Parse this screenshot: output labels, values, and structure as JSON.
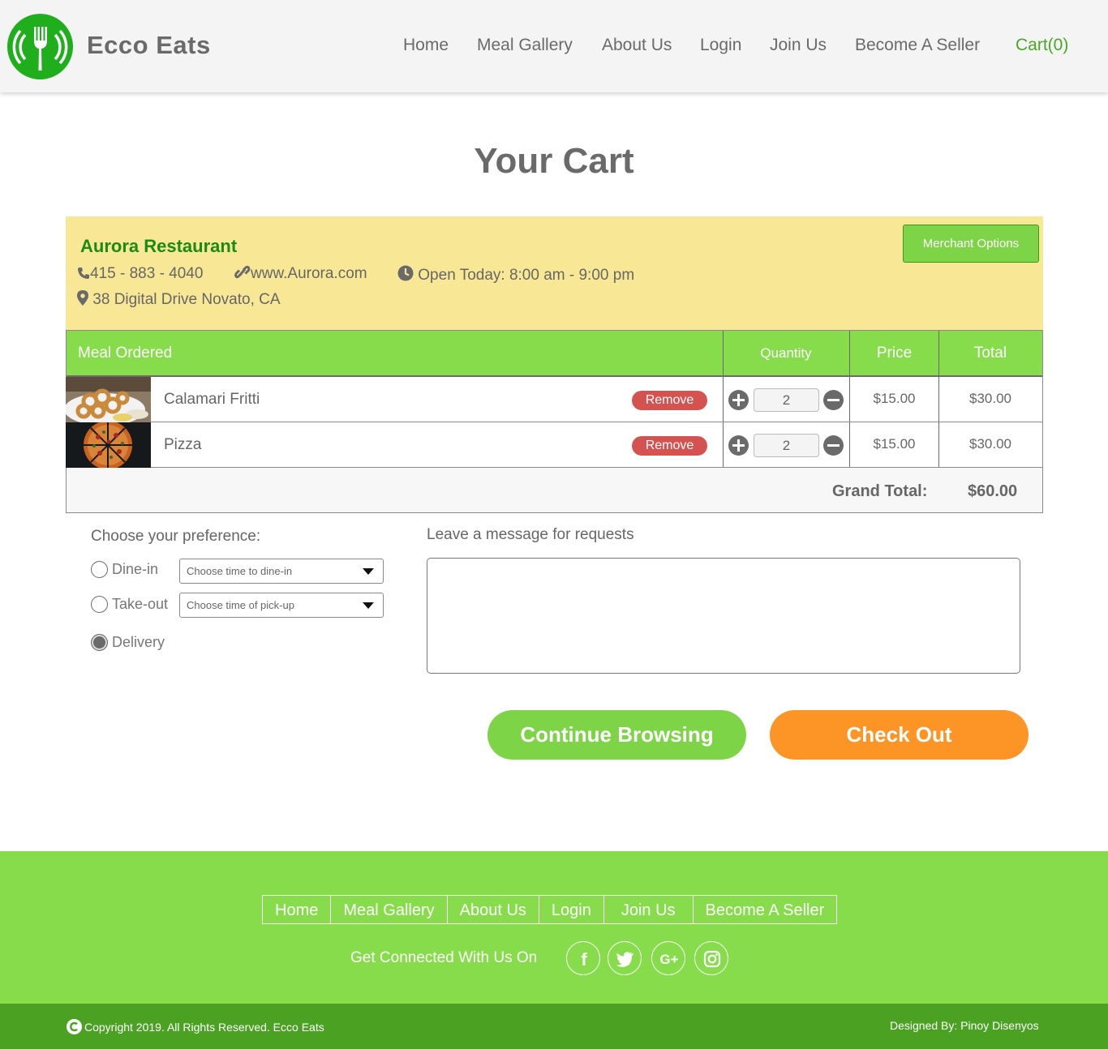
{
  "header": {
    "brand": "Ecco Eats",
    "nav": [
      "Home",
      "Meal Gallery",
      "About Us",
      "Login",
      "Join Us",
      "Become A Seller"
    ],
    "cart_label": "Cart(0)"
  },
  "page": {
    "title": "Your Cart"
  },
  "restaurant": {
    "name": "Aurora Restaurant",
    "phone": "415 - 883 - 4040",
    "website": "www.Aurora.com",
    "hours": "Open Today: 8:00 am - 9:00 pm",
    "address": "38 Digital Drive Novato, CA",
    "merchant_button": "Merchant Options"
  },
  "table": {
    "headers": {
      "meal": "Meal Ordered",
      "quantity": "Quantity",
      "price": "Price",
      "total": "Total"
    },
    "rows": [
      {
        "name": "Calamari Fritti",
        "remove": "Remove",
        "quantity": "2",
        "price": "$15.00",
        "total": "$30.00"
      },
      {
        "name": "Pizza",
        "remove": "Remove",
        "quantity": "2",
        "price": "$15.00",
        "total": "$30.00"
      }
    ],
    "grand_total_label": "Grand Total:",
    "grand_total_value": "$60.00"
  },
  "preferences": {
    "title": "Choose your preference:",
    "options": [
      {
        "label": "Dine-in",
        "select": "Choose time to dine-in",
        "checked": false
      },
      {
        "label": "Take-out",
        "select": "Choose time of pick-up",
        "checked": false
      },
      {
        "label": "Delivery",
        "checked": true
      }
    ]
  },
  "message": {
    "title": "Leave a message for requests",
    "value": ""
  },
  "actions": {
    "continue": "Continue Browsing",
    "checkout": "Check Out"
  },
  "colors": {
    "accent_green": "#86dc4a",
    "dark_green": "#4aa122",
    "orange": "#fd9426",
    "remove_red": "#d45350",
    "panel_yellow": "#f8e895"
  },
  "footer": {
    "nav": [
      "Home",
      "Meal Gallery",
      "About Us",
      "Login",
      "Join Us",
      "Become A Seller"
    ],
    "connect": "Get Connected With Us On",
    "social_icons": [
      "facebook-icon",
      "twitter-icon",
      "google-plus-icon",
      "instagram-icon"
    ],
    "social_labels": [
      "f",
      "G+"
    ],
    "copyright": "Copyright 2019. All Rights Reserved. Ecco Eats",
    "designed_by": "Designed By: Pinoy Disenyos"
  }
}
